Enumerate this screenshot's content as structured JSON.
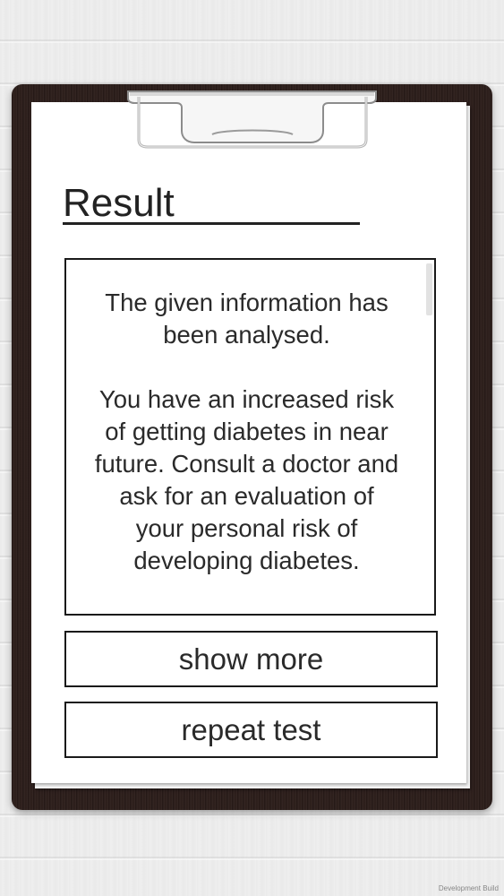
{
  "screen": {
    "title": "Result"
  },
  "result": {
    "paragraph_1": "The given information has\nbeen analysed.",
    "paragraph_2": "You have an increased risk\nof getting diabetes in near\nfuture. Consult a doctor and\nask for an evaluation of\nyour personal risk of\ndeveloping diabetes."
  },
  "buttons": {
    "show_more": "show more",
    "repeat_test": "repeat test"
  },
  "watermark": "Development Build",
  "colors": {
    "board": "#2e1f1c",
    "paper": "#ffffff",
    "text": "#2a2a2a",
    "border": "#1a1a1a"
  }
}
